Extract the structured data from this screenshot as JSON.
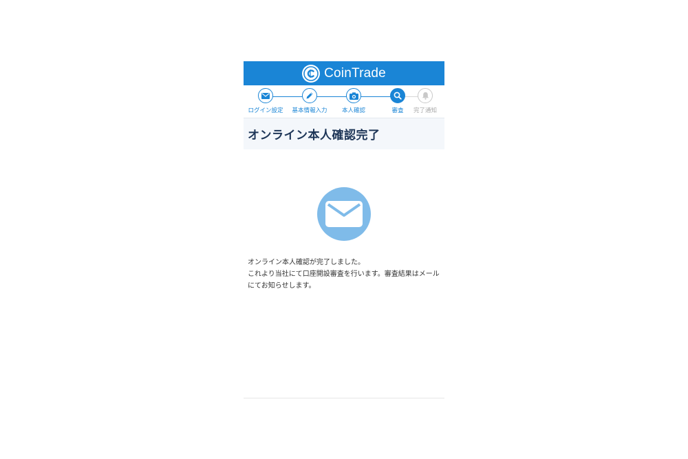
{
  "brand": {
    "name": "CoinTrade",
    "logo_icon": "coin-c-icon",
    "color": "#1a85d6"
  },
  "steps": [
    {
      "label": "ログイン設定",
      "icon": "mail-icon",
      "state": "done"
    },
    {
      "label": "基本情報入力",
      "icon": "pencil-icon",
      "state": "done"
    },
    {
      "label": "本人確認",
      "icon": "camera-icon",
      "state": "done"
    },
    {
      "label": "審査",
      "icon": "search-icon",
      "state": "current"
    },
    {
      "label": "完了通知",
      "icon": "bell-icon",
      "state": "inactive"
    }
  ],
  "page": {
    "title": "オンライン本人確認完了",
    "hero_icon": "envelope-icon",
    "message_line1": "オンライン本人確認が完了しました。",
    "message_line2": "これより当社にて口座開設審査を行います。審査結果はメールにてお知らせします。"
  },
  "colors": {
    "accent": "#1a85d6",
    "hero_circle": "#7fbbe9",
    "inactive": "#c9c9c9"
  }
}
